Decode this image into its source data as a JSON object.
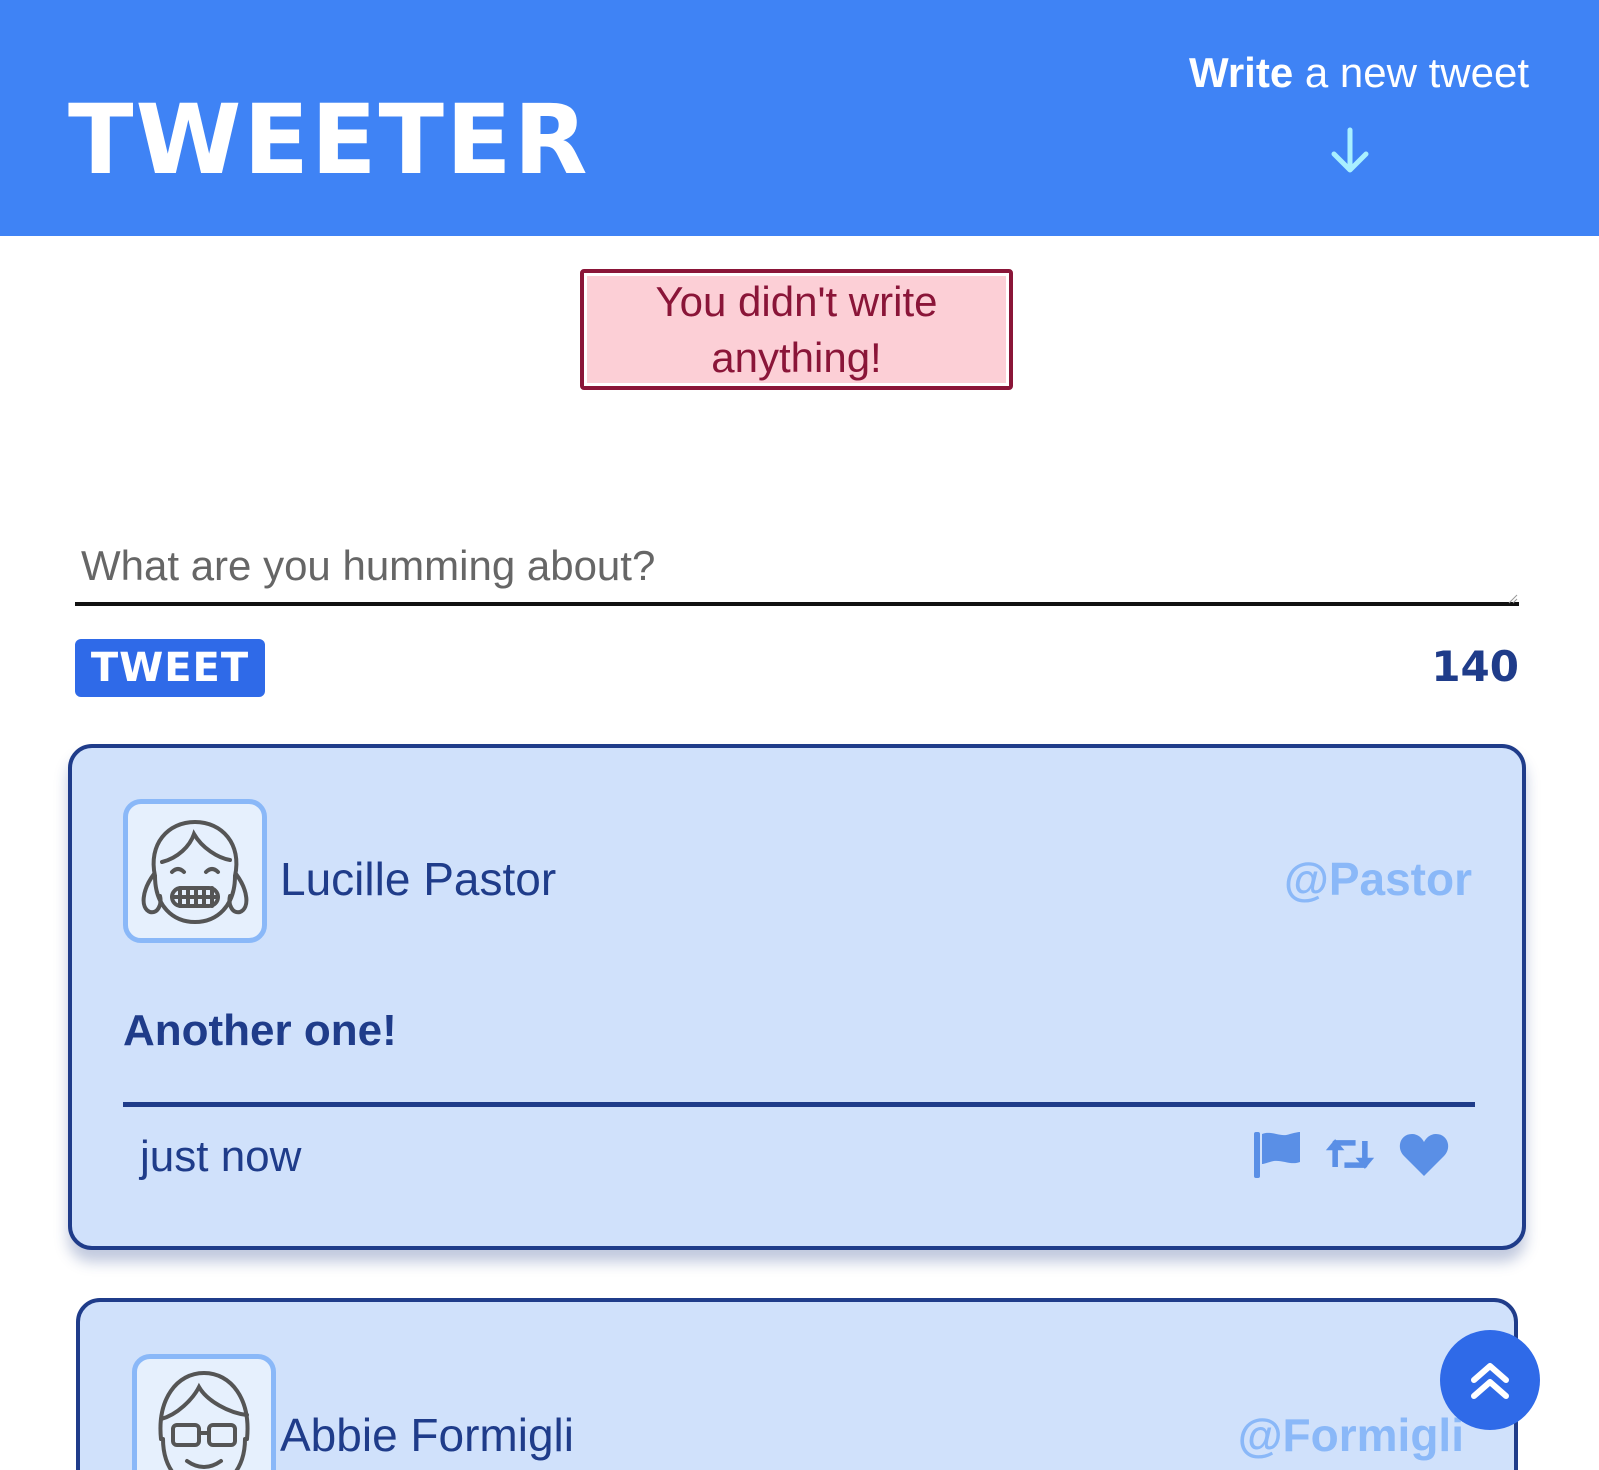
{
  "header": {
    "logo": "Tweeter",
    "write_bold": "Write",
    "write_rest": " a new tweet",
    "arrow_icon": "arrow-down-icon"
  },
  "error": {
    "message": "You didn't write anything!"
  },
  "composer": {
    "placeholder": "What are you humming about?",
    "value": "",
    "button_label": "Tweet",
    "counter": "140"
  },
  "tweets": [
    {
      "name": "Lucille Pastor",
      "handle": "@Pastor",
      "text": "Another one!",
      "time": "just now",
      "actions": [
        "flag-icon",
        "retweet-icon",
        "heart-icon"
      ]
    },
    {
      "name": "Abbie Formigli",
      "handle": "@Formigli"
    }
  ],
  "colors": {
    "brand": "#3f83f5",
    "button": "#2f6ae8",
    "card_bg": "#d0e1fb",
    "card_border": "#1f3c8a",
    "handle": "#8ab8f8",
    "error_bg": "#fccfd6",
    "error_border": "#8a1538"
  },
  "scroll_top_icon": "double-chevron-up-icon"
}
